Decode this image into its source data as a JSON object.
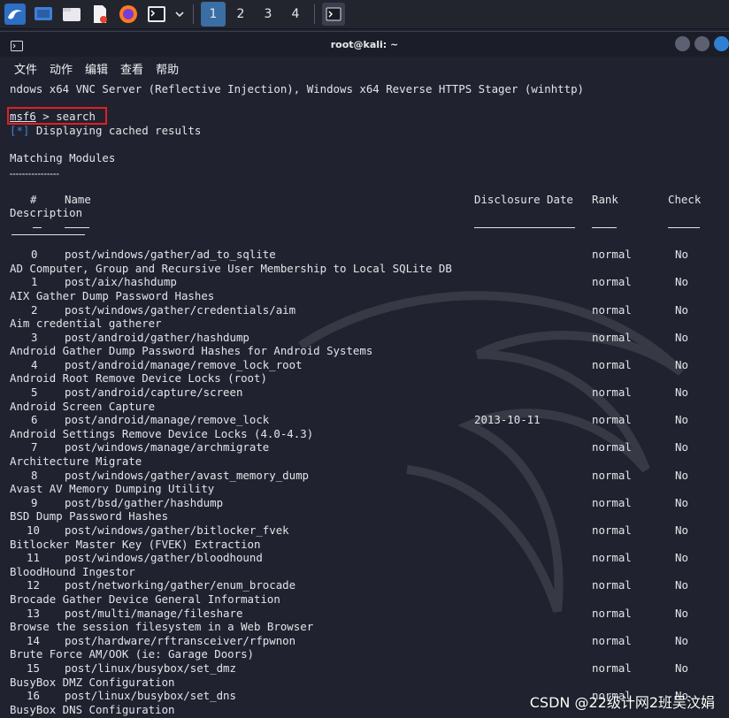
{
  "taskbar": {
    "workspaces": [
      "1",
      "2",
      "3",
      "4"
    ]
  },
  "window": {
    "title": "root@kali: ~"
  },
  "menu": {
    "items": [
      "文件",
      "动作",
      "编辑",
      "查看",
      "帮助"
    ]
  },
  "terminal": {
    "prev_line": "ndows x64 VNC Server (Reflective Injection), Windows x64 Reverse HTTPS Stager (winhttp)",
    "prompt": "msf6",
    "command": " > search",
    "info_marker": "[*]",
    "info_text": " Displaying cached results",
    "section_title": "Matching Modules",
    "headers": {
      "num": "#",
      "name": "Name",
      "date": "Disclosure Date",
      "rank": "Rank",
      "check": "Check",
      "description": "Description"
    },
    "rows": [
      {
        "num": "0",
        "name": "post/windows/gather/ad_to_sqlite",
        "date": "",
        "rank": "normal",
        "check": "No",
        "desc": "AD Computer, Group and Recursive User Membership to Local SQLite DB"
      },
      {
        "num": "1",
        "name": "post/aix/hashdump",
        "date": "",
        "rank": "normal",
        "check": "No",
        "desc": "AIX Gather Dump Password Hashes"
      },
      {
        "num": "2",
        "name": "post/windows/gather/credentials/aim",
        "date": "",
        "rank": "normal",
        "check": "No",
        "desc": "Aim credential gatherer"
      },
      {
        "num": "3",
        "name": "post/android/gather/hashdump",
        "date": "",
        "rank": "normal",
        "check": "No",
        "desc": "Android Gather Dump Password Hashes for Android Systems"
      },
      {
        "num": "4",
        "name": "post/android/manage/remove_lock_root",
        "date": "",
        "rank": "normal",
        "check": "No",
        "desc": "Android Root Remove Device Locks (root)"
      },
      {
        "num": "5",
        "name": "post/android/capture/screen",
        "date": "",
        "rank": "normal",
        "check": "No",
        "desc": "Android Screen Capture"
      },
      {
        "num": "6",
        "name": "post/android/manage/remove_lock",
        "date": "2013-10-11",
        "rank": "normal",
        "check": "No",
        "desc": "Android Settings Remove Device Locks (4.0-4.3)"
      },
      {
        "num": "7",
        "name": "post/windows/manage/archmigrate",
        "date": "",
        "rank": "normal",
        "check": "No",
        "desc": "Architecture Migrate"
      },
      {
        "num": "8",
        "name": "post/windows/gather/avast_memory_dump",
        "date": "",
        "rank": "normal",
        "check": "No",
        "desc": "Avast AV Memory Dumping Utility"
      },
      {
        "num": "9",
        "name": "post/bsd/gather/hashdump",
        "date": "",
        "rank": "normal",
        "check": "No",
        "desc": "BSD Dump Password Hashes"
      },
      {
        "num": "10",
        "name": "post/windows/gather/bitlocker_fvek",
        "date": "",
        "rank": "normal",
        "check": "No",
        "desc": "Bitlocker Master Key (FVEK) Extraction"
      },
      {
        "num": "11",
        "name": "post/windows/gather/bloodhound",
        "date": "",
        "rank": "normal",
        "check": "No",
        "desc": "BloodHound Ingestor"
      },
      {
        "num": "12",
        "name": "post/networking/gather/enum_brocade",
        "date": "",
        "rank": "normal",
        "check": "No",
        "desc": "Brocade Gather Device General Information"
      },
      {
        "num": "13",
        "name": "post/multi/manage/fileshare",
        "date": "",
        "rank": "normal",
        "check": "No",
        "desc": "Browse the session filesystem in a Web Browser"
      },
      {
        "num": "14",
        "name": "post/hardware/rftransceiver/rfpwnon",
        "date": "",
        "rank": "normal",
        "check": "No",
        "desc": "Brute Force AM/OOK (ie: Garage Doors)"
      },
      {
        "num": "15",
        "name": "post/linux/busybox/set_dmz",
        "date": "",
        "rank": "normal",
        "check": "No",
        "desc": "BusyBox DMZ Configuration"
      },
      {
        "num": "16",
        "name": "post/linux/busybox/set_dns",
        "date": "",
        "rank": "normal",
        "check": "No",
        "desc": "BusyBox DNS Configuration"
      }
    ]
  },
  "watermark": "CSDN @22级计网2班吴汶娟"
}
